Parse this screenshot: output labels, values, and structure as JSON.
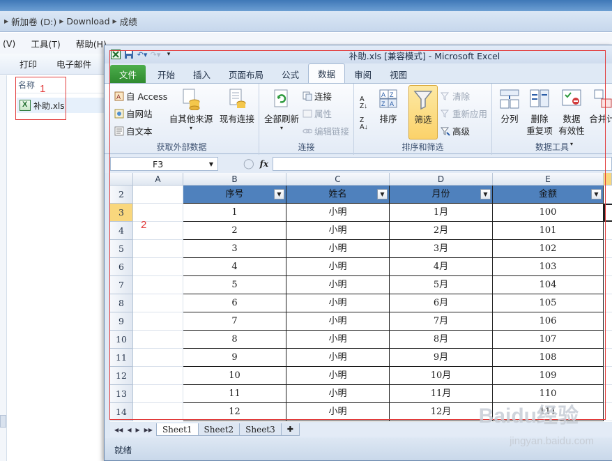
{
  "explorer": {
    "breadcrumb": [
      "新加卷 (D:)",
      "Download",
      "成绩"
    ],
    "menu": [
      "(V)",
      "工具(T)",
      "帮助(H)"
    ],
    "toolbar": [
      "打印",
      "电子邮件"
    ],
    "column_header": "名称",
    "file": "补助.xls"
  },
  "annotations": {
    "box1": "1",
    "box2": "2",
    "color": "#e23a3a"
  },
  "excel": {
    "title": "补助.xls [兼容模式] - Microsoft Excel",
    "tabs": [
      "文件",
      "开始",
      "插入",
      "页面布局",
      "公式",
      "数据",
      "审阅",
      "视图"
    ],
    "active_tab": "数据",
    "ribbon": {
      "external": {
        "label": "获取外部数据",
        "from_access": "自 Access",
        "from_web": "自网站",
        "from_text": "自文本",
        "from_other": "自其他来源",
        "existing": "现有连接"
      },
      "connections": {
        "label": "连接",
        "refresh_all": "全部刷新",
        "connections": "连接",
        "properties": "属性",
        "edit_links": "编辑链接"
      },
      "sort_filter": {
        "label": "排序和筛选",
        "sort": "排序",
        "filter": "筛选",
        "clear": "清除",
        "reapply": "重新应用",
        "advanced": "高级"
      },
      "data_tools": {
        "label": "数据工具",
        "text_to_columns": "分列",
        "remove_dup_1": "删除",
        "remove_dup_2": "重复项",
        "validation_1": "数据",
        "validation_2": "有效性",
        "consolidate": "合并计"
      }
    },
    "name_box": "F3",
    "fx": "fx",
    "columns": [
      "A",
      "B",
      "C",
      "D",
      "E"
    ],
    "row_numbers": [
      "2",
      "3",
      "4",
      "5",
      "6",
      "7",
      "8",
      "9",
      "10",
      "11",
      "12",
      "13",
      "14"
    ],
    "selected_row": "3",
    "table_headers": [
      "序号",
      "姓名",
      "月份",
      "金额"
    ],
    "table_rows": [
      [
        "1",
        "小明",
        "1月",
        "100"
      ],
      [
        "2",
        "小明",
        "2月",
        "101"
      ],
      [
        "3",
        "小明",
        "3月",
        "102"
      ],
      [
        "4",
        "小明",
        "4月",
        "103"
      ],
      [
        "5",
        "小明",
        "5月",
        "104"
      ],
      [
        "6",
        "小明",
        "6月",
        "105"
      ],
      [
        "7",
        "小明",
        "7月",
        "106"
      ],
      [
        "8",
        "小明",
        "8月",
        "107"
      ],
      [
        "9",
        "小明",
        "9月",
        "108"
      ],
      [
        "10",
        "小明",
        "10月",
        "109"
      ],
      [
        "11",
        "小明",
        "11月",
        "110"
      ],
      [
        "12",
        "小明",
        "12月",
        "111"
      ]
    ],
    "header_color": "#4f81bd",
    "sheets": [
      "Sheet1",
      "Sheet2",
      "Sheet3"
    ],
    "active_sheet": "Sheet1",
    "status": "就绪"
  },
  "watermark": {
    "main": "Baidu经验",
    "sub": "jingyan.baidu.com"
  }
}
